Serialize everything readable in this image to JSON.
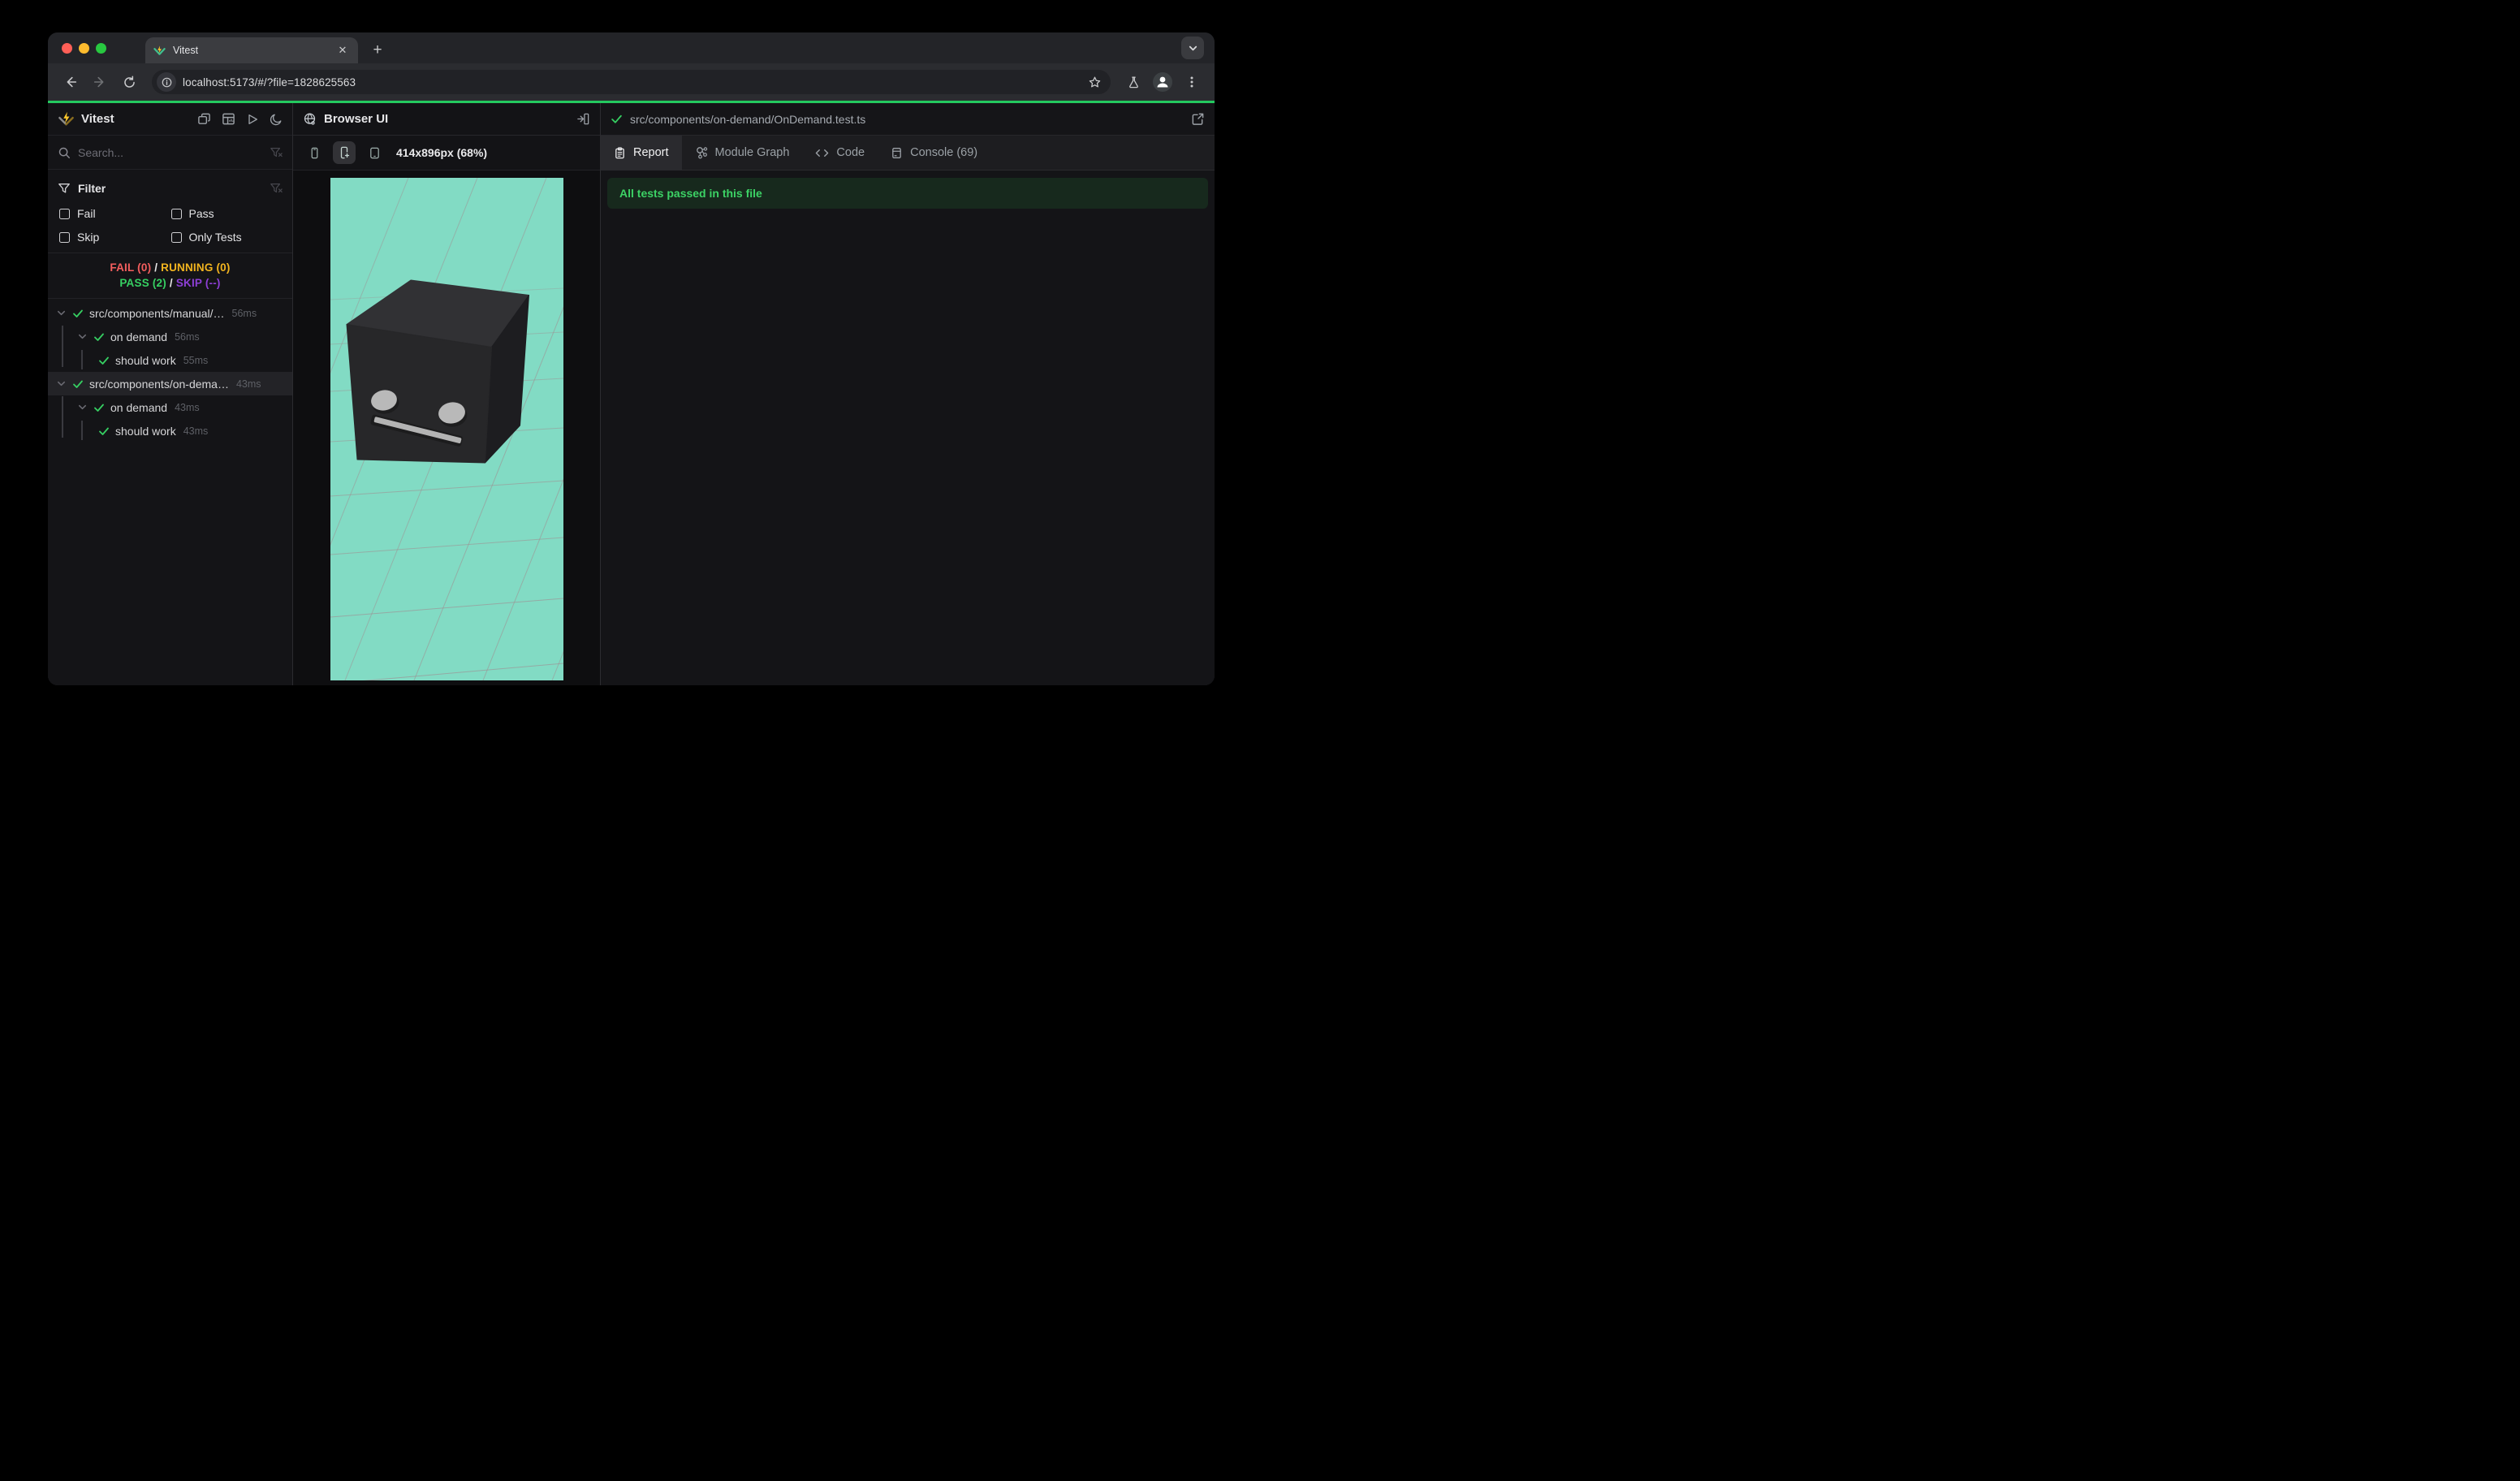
{
  "colors": {
    "accent": "#24c95f",
    "mint": "#82dbc4",
    "fail": "#f45e5e",
    "running": "#f2b41f",
    "pass": "#36cf62",
    "skip": "#8d3fd6",
    "banner-bg": "#17291d",
    "banner-text": "#3cd265"
  },
  "browser": {
    "tab_title": "Vitest",
    "url": "localhost:5173/#/?file=1828625563",
    "close_label": "✕",
    "newtab_label": "+"
  },
  "sidebar": {
    "app_title": "Vitest",
    "search_placeholder": "Search...",
    "filter": {
      "title": "Filter",
      "options": [
        {
          "label": "Fail",
          "checked": false
        },
        {
          "label": "Pass",
          "checked": false
        },
        {
          "label": "Skip",
          "checked": false
        },
        {
          "label": "Only Tests",
          "checked": false
        }
      ]
    },
    "status": {
      "fail": "FAIL (0)",
      "running": "RUNNING (0)",
      "pass": "PASS (2)",
      "skip": "SKIP (--)",
      "separator": "/"
    },
    "tree": [
      {
        "label": "src/components/manual/…",
        "duration": "56ms",
        "level": 0,
        "state": "pass"
      },
      {
        "label": "on demand",
        "duration": "56ms",
        "level": 1,
        "state": "pass"
      },
      {
        "label": "should work",
        "duration": "55ms",
        "level": 2,
        "state": "pass"
      },
      {
        "label": "src/components/on-dema…",
        "duration": "43ms",
        "level": 0,
        "state": "pass",
        "selected": true
      },
      {
        "label": "on demand",
        "duration": "43ms",
        "level": 1,
        "state": "pass"
      },
      {
        "label": "should work",
        "duration": "43ms",
        "level": 2,
        "state": "pass"
      }
    ]
  },
  "browser_panel": {
    "title": "Browser UI",
    "viewport_size": "414x896px (68%)"
  },
  "report_panel": {
    "file_path": "src/components/on-demand/OnDemand.test.ts",
    "tabs": [
      {
        "label": "Report",
        "active": true
      },
      {
        "label": "Module Graph",
        "active": false
      },
      {
        "label": "Code",
        "active": false
      },
      {
        "label": "Console (69)",
        "active": false
      }
    ],
    "banner": "All tests passed in this file"
  }
}
